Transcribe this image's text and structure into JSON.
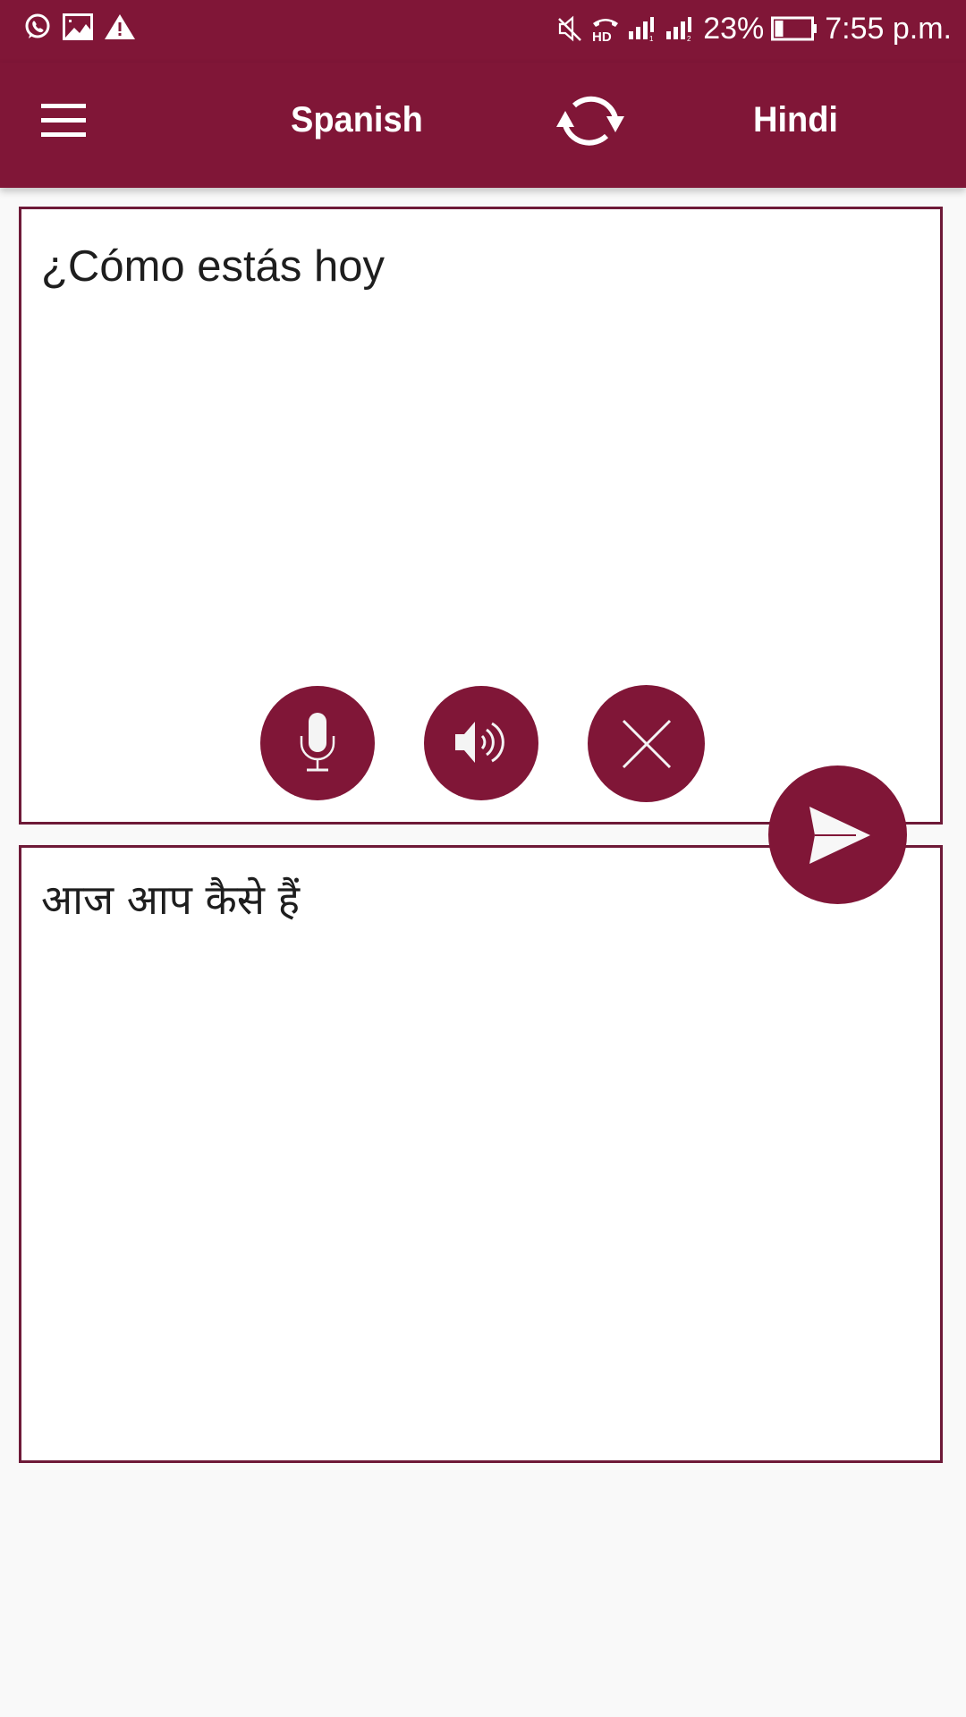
{
  "status_bar": {
    "left_icons": [
      "whatsapp-icon",
      "image-icon",
      "warning-icon"
    ],
    "right_icons": [
      "mute-icon",
      "hd-call-icon",
      "signal-sim1-icon",
      "signal-sim2-icon",
      "battery-icon"
    ],
    "battery_percent": "23%",
    "battery_level": 0.23,
    "time": "7:55 p.m."
  },
  "app_bar": {
    "menu_icon": "hamburger-menu-icon",
    "source_language": "Spanish",
    "swap_icon": "swap-languages-icon",
    "target_language": "Hindi"
  },
  "source_box": {
    "text": "¿Cómo estás hoy"
  },
  "actions": [
    {
      "name": "microphone",
      "icon": "microphone-icon"
    },
    {
      "name": "speak",
      "icon": "speaker-icon"
    },
    {
      "name": "clear",
      "icon": "close-icon"
    },
    {
      "name": "translate",
      "icon": "send-icon"
    }
  ],
  "target_box": {
    "text": "आज आप कैसे हैं"
  },
  "colors": {
    "primary": "#801637",
    "border": "#6e1a38",
    "background": "#f9f9f9",
    "text": "#1e1e1e"
  }
}
